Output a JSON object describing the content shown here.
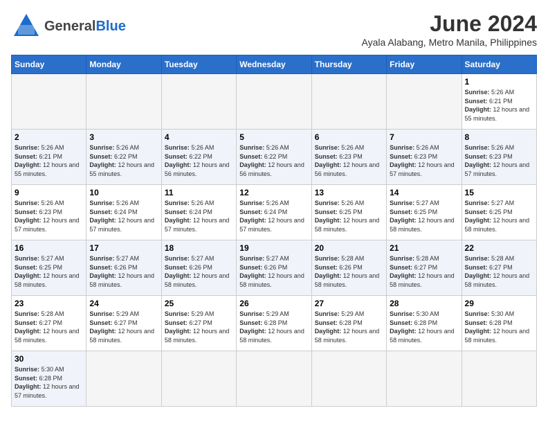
{
  "header": {
    "logo_general": "General",
    "logo_blue": "Blue",
    "title": "June 2024",
    "subtitle": "Ayala Alabang, Metro Manila, Philippines"
  },
  "days_of_week": [
    "Sunday",
    "Monday",
    "Tuesday",
    "Wednesday",
    "Thursday",
    "Friday",
    "Saturday"
  ],
  "weeks": [
    [
      {
        "day": "",
        "empty": true
      },
      {
        "day": "",
        "empty": true
      },
      {
        "day": "",
        "empty": true
      },
      {
        "day": "",
        "empty": true
      },
      {
        "day": "",
        "empty": true
      },
      {
        "day": "",
        "empty": true
      },
      {
        "day": "1",
        "sunrise": "5:26 AM",
        "sunset": "6:21 PM",
        "daylight": "12 hours and 55 minutes."
      }
    ],
    [
      {
        "day": "2",
        "sunrise": "5:26 AM",
        "sunset": "6:21 PM",
        "daylight": "12 hours and 55 minutes."
      },
      {
        "day": "3",
        "sunrise": "5:26 AM",
        "sunset": "6:22 PM",
        "daylight": "12 hours and 55 minutes."
      },
      {
        "day": "4",
        "sunrise": "5:26 AM",
        "sunset": "6:22 PM",
        "daylight": "12 hours and 56 minutes."
      },
      {
        "day": "5",
        "sunrise": "5:26 AM",
        "sunset": "6:22 PM",
        "daylight": "12 hours and 56 minutes."
      },
      {
        "day": "6",
        "sunrise": "5:26 AM",
        "sunset": "6:23 PM",
        "daylight": "12 hours and 56 minutes."
      },
      {
        "day": "7",
        "sunrise": "5:26 AM",
        "sunset": "6:23 PM",
        "daylight": "12 hours and 57 minutes."
      },
      {
        "day": "8",
        "sunrise": "5:26 AM",
        "sunset": "6:23 PM",
        "daylight": "12 hours and 57 minutes."
      }
    ],
    [
      {
        "day": "9",
        "sunrise": "5:26 AM",
        "sunset": "6:23 PM",
        "daylight": "12 hours and 57 minutes."
      },
      {
        "day": "10",
        "sunrise": "5:26 AM",
        "sunset": "6:24 PM",
        "daylight": "12 hours and 57 minutes."
      },
      {
        "day": "11",
        "sunrise": "5:26 AM",
        "sunset": "6:24 PM",
        "daylight": "12 hours and 57 minutes."
      },
      {
        "day": "12",
        "sunrise": "5:26 AM",
        "sunset": "6:24 PM",
        "daylight": "12 hours and 57 minutes."
      },
      {
        "day": "13",
        "sunrise": "5:26 AM",
        "sunset": "6:25 PM",
        "daylight": "12 hours and 58 minutes."
      },
      {
        "day": "14",
        "sunrise": "5:27 AM",
        "sunset": "6:25 PM",
        "daylight": "12 hours and 58 minutes."
      },
      {
        "day": "15",
        "sunrise": "5:27 AM",
        "sunset": "6:25 PM",
        "daylight": "12 hours and 58 minutes."
      }
    ],
    [
      {
        "day": "16",
        "sunrise": "5:27 AM",
        "sunset": "6:25 PM",
        "daylight": "12 hours and 58 minutes."
      },
      {
        "day": "17",
        "sunrise": "5:27 AM",
        "sunset": "6:26 PM",
        "daylight": "12 hours and 58 minutes."
      },
      {
        "day": "18",
        "sunrise": "5:27 AM",
        "sunset": "6:26 PM",
        "daylight": "12 hours and 58 minutes."
      },
      {
        "day": "19",
        "sunrise": "5:27 AM",
        "sunset": "6:26 PM",
        "daylight": "12 hours and 58 minutes."
      },
      {
        "day": "20",
        "sunrise": "5:28 AM",
        "sunset": "6:26 PM",
        "daylight": "12 hours and 58 minutes."
      },
      {
        "day": "21",
        "sunrise": "5:28 AM",
        "sunset": "6:27 PM",
        "daylight": "12 hours and 58 minutes."
      },
      {
        "day": "22",
        "sunrise": "5:28 AM",
        "sunset": "6:27 PM",
        "daylight": "12 hours and 58 minutes."
      }
    ],
    [
      {
        "day": "23",
        "sunrise": "5:28 AM",
        "sunset": "6:27 PM",
        "daylight": "12 hours and 58 minutes."
      },
      {
        "day": "24",
        "sunrise": "5:29 AM",
        "sunset": "6:27 PM",
        "daylight": "12 hours and 58 minutes."
      },
      {
        "day": "25",
        "sunrise": "5:29 AM",
        "sunset": "6:27 PM",
        "daylight": "12 hours and 58 minutes."
      },
      {
        "day": "26",
        "sunrise": "5:29 AM",
        "sunset": "6:28 PM",
        "daylight": "12 hours and 58 minutes."
      },
      {
        "day": "27",
        "sunrise": "5:29 AM",
        "sunset": "6:28 PM",
        "daylight": "12 hours and 58 minutes."
      },
      {
        "day": "28",
        "sunrise": "5:30 AM",
        "sunset": "6:28 PM",
        "daylight": "12 hours and 58 minutes."
      },
      {
        "day": "29",
        "sunrise": "5:30 AM",
        "sunset": "6:28 PM",
        "daylight": "12 hours and 58 minutes."
      }
    ],
    [
      {
        "day": "30",
        "sunrise": "5:30 AM",
        "sunset": "6:28 PM",
        "daylight": "12 hours and 57 minutes."
      },
      {
        "day": "",
        "empty": true
      },
      {
        "day": "",
        "empty": true
      },
      {
        "day": "",
        "empty": true
      },
      {
        "day": "",
        "empty": true
      },
      {
        "day": "",
        "empty": true
      },
      {
        "day": "",
        "empty": true
      }
    ]
  ],
  "labels": {
    "sunrise": "Sunrise:",
    "sunset": "Sunset:",
    "daylight": "Daylight:"
  }
}
